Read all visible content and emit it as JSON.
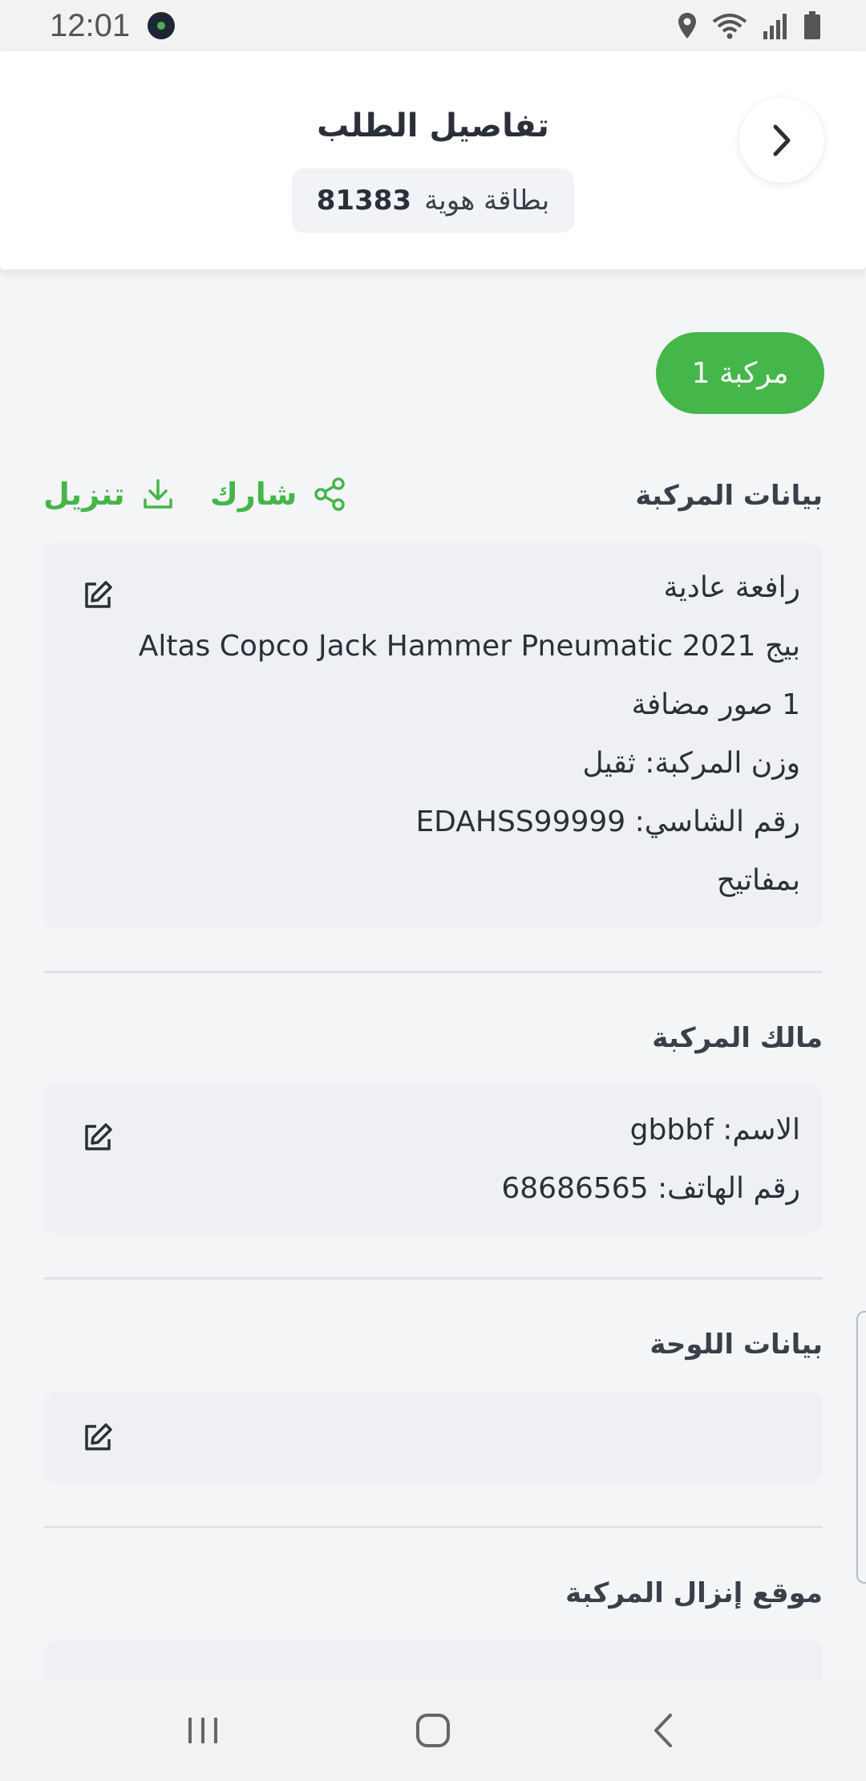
{
  "status_bar": {
    "time": "12:01",
    "icons": [
      "notification-dot",
      "location-icon",
      "wifi-icon",
      "signal-icon",
      "battery-icon"
    ]
  },
  "header": {
    "title": "تفاصيل الطلب",
    "id_label": "بطاقة هوية",
    "id_value": "81383",
    "back_icon": "chevron-right-icon"
  },
  "vehicle_tab": {
    "label": "مركبة 1"
  },
  "vehicle_data": {
    "title": "بيانات المركبة",
    "share_label": "شارك",
    "download_label": "تنزيل",
    "lines": [
      "رافعة عادية",
      "بيج Altas Copco Jack Hammer Pneumatic 2021",
      "1 صور مضافة",
      "وزن المركبة: ثقيل",
      "رقم الشاسي: EDAHSS99999",
      "بمفاتيح"
    ]
  },
  "vehicle_owner": {
    "title": "مالك المركبة",
    "lines": [
      "الاسم: gbbbf",
      "رقم الهاتف: 68686565"
    ]
  },
  "plate_data": {
    "title": "بيانات اللوحة"
  },
  "dropoff_location": {
    "title": "موقع إنزال المركبة"
  },
  "colors": {
    "accent": "#45b649",
    "card_bg": "#eef0f3",
    "page_bg": "#f4f5f7"
  }
}
